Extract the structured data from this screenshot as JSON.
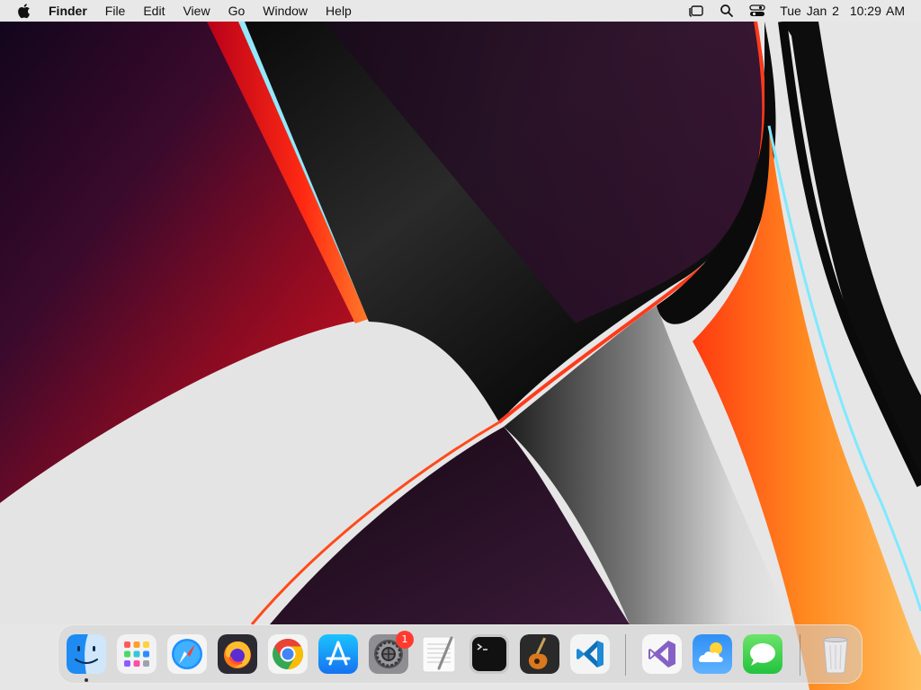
{
  "menubar": {
    "app_name": "Finder",
    "menus": [
      "File",
      "Edit",
      "View",
      "Go",
      "Window",
      "Help"
    ],
    "clock": {
      "date": "Tue Jan 2",
      "time": "10:29 AM"
    },
    "status_icons": [
      "stage-manager-icon",
      "spotlight-search-icon",
      "control-center-icon"
    ]
  },
  "dock": {
    "apps": [
      {
        "name": "Finder",
        "icon": "finder-icon",
        "running": true
      },
      {
        "name": "Launchpad",
        "icon": "launchpad-icon",
        "running": false
      },
      {
        "name": "Safari",
        "icon": "safari-icon",
        "running": false
      },
      {
        "name": "Firefox",
        "icon": "firefox-icon",
        "running": false
      },
      {
        "name": "Google Chrome",
        "icon": "chrome-icon",
        "running": false
      },
      {
        "name": "App Store",
        "icon": "app-store-icon",
        "running": false
      },
      {
        "name": "System Settings",
        "icon": "system-settings-icon",
        "running": false,
        "badge": "1"
      },
      {
        "name": "TextEdit",
        "icon": "textedit-icon",
        "running": false
      },
      {
        "name": "Terminal",
        "icon": "terminal-icon",
        "running": false
      },
      {
        "name": "GarageBand",
        "icon": "garageband-icon",
        "running": false
      },
      {
        "name": "Visual Studio Code",
        "icon": "vscode-icon",
        "running": false
      }
    ],
    "recent_apps": [
      {
        "name": "Visual Studio",
        "icon": "visual-studio-icon"
      },
      {
        "name": "Weather",
        "icon": "weather-icon"
      },
      {
        "name": "Messages",
        "icon": "messages-icon"
      }
    ],
    "trash": {
      "name": "Trash",
      "icon": "trash-icon"
    }
  },
  "colors": {
    "menubar_bg": "#e8e8e8",
    "badge": "#ff3b30",
    "accent_blue": "#0a84ff"
  }
}
